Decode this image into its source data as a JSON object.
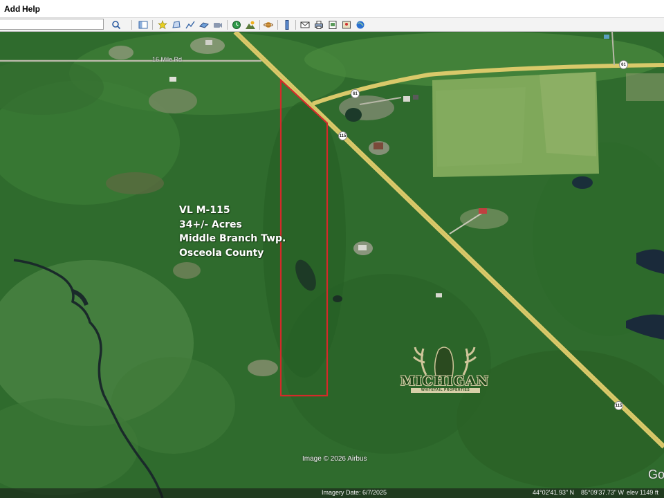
{
  "menu": {
    "add": "Add",
    "help": "Help"
  },
  "search": {
    "value": "",
    "placeholder": ""
  },
  "toolbar": {
    "icons": [
      "search-icon",
      "sidebar-toggle-icon",
      "placemark-icon",
      "polygon-icon",
      "path-icon",
      "image-overlay-icon",
      "tour-icon",
      "historical-imagery-icon",
      "sun-icon",
      "planets-icon",
      "ruler-icon",
      "email-icon",
      "print-icon",
      "save-image-icon",
      "globe-icon"
    ]
  },
  "map": {
    "parcel": {
      "line1": "VL M-115",
      "line2": "34+/- Acres",
      "line3": "Middle Branch Twp.",
      "line4": "Osceola County",
      "boundary_color": "#d42a2a"
    },
    "roads": {
      "mile_road": "16 Mile Rd",
      "route_61": "61",
      "route_115": "115",
      "road_color": "#d9c96a"
    },
    "logo": {
      "word": "MICHIGAN",
      "sub": "WHITETAIL PROPERTIES"
    },
    "attribution": "Image © 2026 Airbus",
    "google_mark": "Go"
  },
  "status": {
    "imagery_date": "Imagery Date: 6/7/2025",
    "lat": "44°02'41.93\" N",
    "lon": "85°09'37.73\" W",
    "elev": "elev  1149 ft"
  }
}
